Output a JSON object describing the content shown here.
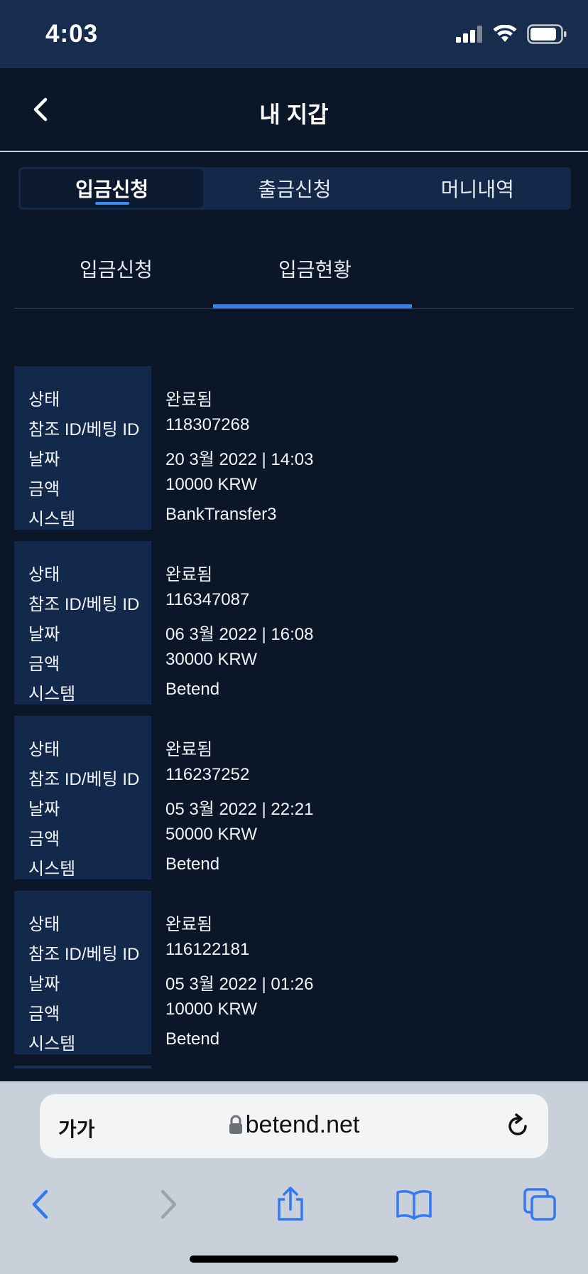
{
  "status_bar": {
    "time": "4:03"
  },
  "header": {
    "title": "내 지갑"
  },
  "main_tabs": [
    {
      "label": "입금신청",
      "active": true
    },
    {
      "label": "출금신청",
      "active": false
    },
    {
      "label": "머니내역",
      "active": false
    }
  ],
  "sub_tabs": [
    {
      "label": "입금신청",
      "active": false
    },
    {
      "label": "입금현황",
      "active": true
    }
  ],
  "field_labels": {
    "status": "상태",
    "ref_id": "참조 ID/베팅 ID",
    "date": "날짜",
    "amount": "금액",
    "system": "시스템"
  },
  "records": [
    {
      "status": "완료됨",
      "ref_id": "118307268",
      "date": "20 3월 2022 | 14:03",
      "amount": "10000 KRW",
      "system": "BankTransfer3"
    },
    {
      "status": "완료됨",
      "ref_id": "116347087",
      "date": "06 3월 2022 | 16:08",
      "amount": "30000 KRW",
      "system": "Betend"
    },
    {
      "status": "완료됨",
      "ref_id": "116237252",
      "date": "05 3월 2022 | 22:21",
      "amount": "50000 KRW",
      "system": "Betend"
    },
    {
      "status": "완료됨",
      "ref_id": "116122181",
      "date": "05 3월 2022 | 01:26",
      "amount": "10000 KRW",
      "system": "Betend"
    }
  ],
  "browser": {
    "text_size_label": "가가",
    "url": "betend.net"
  },
  "icons": {
    "back": "chevron-left-icon",
    "lock": "lock-icon",
    "reload": "reload-icon",
    "share": "share-icon",
    "bookmarks": "book-icon",
    "tabs": "tabs-icon"
  },
  "colors": {
    "background": "#0b1628",
    "accent": "#3a8df5",
    "browser_blue": "#3478f6"
  }
}
